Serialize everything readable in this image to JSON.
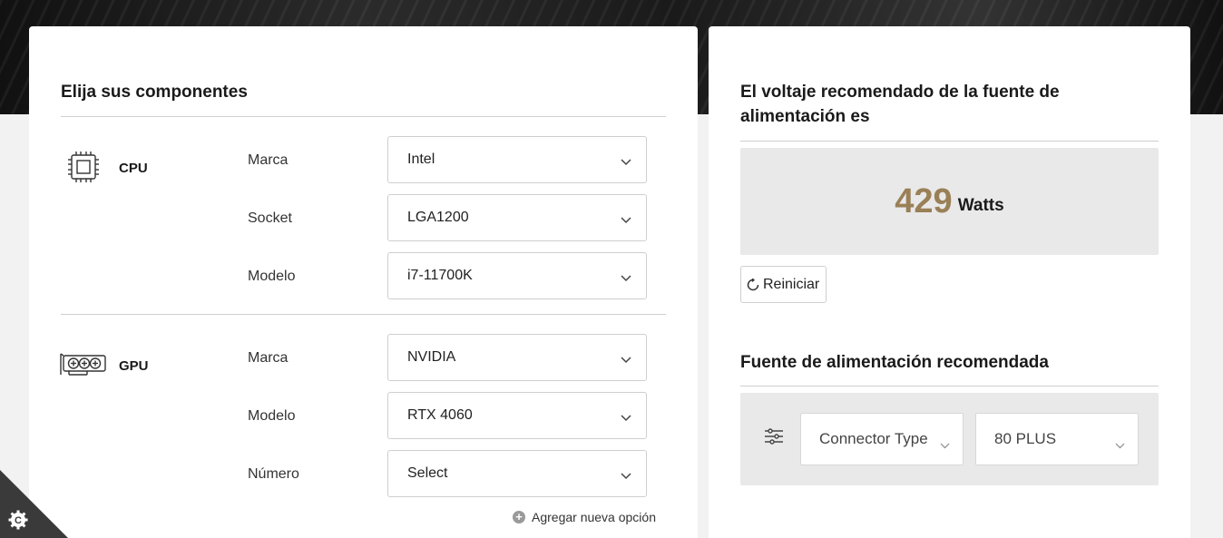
{
  "left_card": {
    "heading": "Elija sus componentes",
    "components": [
      {
        "label": "CPU",
        "icon": "cpu-icon",
        "fields": [
          {
            "label": "Marca",
            "value": "Intel"
          },
          {
            "label": "Socket",
            "value": "LGA1200"
          },
          {
            "label": "Modelo",
            "value": "i7-11700K"
          }
        ]
      },
      {
        "label": "GPU",
        "icon": "gpu-icon",
        "fields": [
          {
            "label": "Marca",
            "value": "NVIDIA"
          },
          {
            "label": "Modelo",
            "value": "RTX 4060"
          },
          {
            "label": "Número",
            "value": "Select"
          }
        ]
      }
    ],
    "add_option": "Agregar nueva opción"
  },
  "right_card": {
    "heading": "El voltaje recomendado de la fuente de alimentación es",
    "watts_value": "429",
    "watts_unit": "Watts",
    "reset_label": "Reiniciar",
    "psu_heading": "Fuente de alimentación recomendada",
    "filters": {
      "connector_type": "Connector Type",
      "efficiency": "80 PLUS"
    }
  },
  "colors": {
    "accent_watts": "#9a8057",
    "panel_gray": "#e9e9e9"
  },
  "icons": [
    "cpu-icon",
    "gpu-icon",
    "chevron-down-icon",
    "plus-circle-icon",
    "reset-icon",
    "filter-sliders-icon",
    "cookie-settings-icon"
  ]
}
